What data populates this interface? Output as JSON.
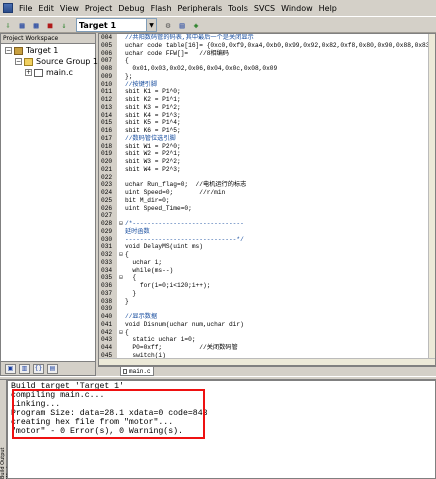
{
  "menubar": {
    "items": [
      "File",
      "Edit",
      "View",
      "Project",
      "Debug",
      "Flash",
      "Peripherals",
      "Tools",
      "SVCS",
      "Window",
      "Help"
    ]
  },
  "toolbar": {
    "target": "Target 1"
  },
  "sidebar": {
    "title": "Project Workspace",
    "tree": [
      {
        "label": "Target 1",
        "expander": "−"
      },
      {
        "label": "Source Group 1",
        "expander": "−"
      },
      {
        "label": "main.c",
        "expander": "+"
      }
    ]
  },
  "editor": {
    "lines": [
      {
        "n": "004",
        "f": "",
        "t": "//共阳数码管的码表,其中最后一个是关闭显示",
        "c": "cm"
      },
      {
        "n": "005",
        "f": "",
        "t": "uchar code table[16]= {0xc0,0xf9,0xa4,0xb0,0x99,0x92,0x82,0xf8,0x80,0x90,0x88,0x83,0xc6,0xa1,0x86,0xff};",
        "c": ""
      },
      {
        "n": "006",
        "f": "",
        "t": "uchar code FFW[]=   //8相编码",
        "c": ""
      },
      {
        "n": "007",
        "f": "",
        "t": "{",
        "c": ""
      },
      {
        "n": "008",
        "f": "",
        "t": "  0x01,0x03,0x02,0x06,0x04,0x0c,0x08,0x09",
        "c": ""
      },
      {
        "n": "009",
        "f": "",
        "t": "};",
        "c": ""
      },
      {
        "n": "010",
        "f": "",
        "t": "//按键引脚",
        "c": "cm"
      },
      {
        "n": "011",
        "f": "",
        "t": "sbit K1 = P1^0;",
        "c": ""
      },
      {
        "n": "012",
        "f": "",
        "t": "sbit K2 = P1^1;",
        "c": ""
      },
      {
        "n": "013",
        "f": "",
        "t": "sbit K3 = P1^2;",
        "c": ""
      },
      {
        "n": "014",
        "f": "",
        "t": "sbit K4 = P1^3;",
        "c": ""
      },
      {
        "n": "015",
        "f": "",
        "t": "sbit K5 = P1^4;",
        "c": ""
      },
      {
        "n": "016",
        "f": "",
        "t": "sbit K6 = P1^5;",
        "c": ""
      },
      {
        "n": "017",
        "f": "",
        "t": "//数码管位选引脚",
        "c": "cm"
      },
      {
        "n": "018",
        "f": "",
        "t": "sbit W1 = P2^0;",
        "c": ""
      },
      {
        "n": "019",
        "f": "",
        "t": "sbit W2 = P2^1;",
        "c": ""
      },
      {
        "n": "020",
        "f": "",
        "t": "sbit W3 = P2^2;",
        "c": ""
      },
      {
        "n": "021",
        "f": "",
        "t": "sbit W4 = P2^3;",
        "c": ""
      },
      {
        "n": "022",
        "f": "",
        "t": "",
        "c": ""
      },
      {
        "n": "023",
        "f": "",
        "t": "uchar Run_flag=0;  //电机运行的标志",
        "c": ""
      },
      {
        "n": "024",
        "f": "",
        "t": "uint Speed=0;       //r/min",
        "c": ""
      },
      {
        "n": "025",
        "f": "",
        "t": "bit M_dir=0;",
        "c": ""
      },
      {
        "n": "026",
        "f": "",
        "t": "uint Speed_Time=0;",
        "c": ""
      },
      {
        "n": "027",
        "f": "",
        "t": "",
        "c": ""
      },
      {
        "n": "028",
        "f": "⊟",
        "t": "/*------------------------------",
        "c": "cm"
      },
      {
        "n": "029",
        "f": "",
        "t": "延时函数",
        "c": "cm"
      },
      {
        "n": "030",
        "f": "",
        "t": "------------------------------*/",
        "c": "cm"
      },
      {
        "n": "031",
        "f": "",
        "t": "void DelayMS(uint ms)",
        "c": ""
      },
      {
        "n": "032",
        "f": "⊟",
        "t": "{",
        "c": ""
      },
      {
        "n": "033",
        "f": "",
        "t": "  uchar i;",
        "c": ""
      },
      {
        "n": "034",
        "f": "",
        "t": "  while(ms--)",
        "c": ""
      },
      {
        "n": "035",
        "f": "⊟",
        "t": "  {",
        "c": ""
      },
      {
        "n": "036",
        "f": "",
        "t": "    for(i=0;i<120;i++);",
        "c": ""
      },
      {
        "n": "037",
        "f": "",
        "t": "  }",
        "c": ""
      },
      {
        "n": "038",
        "f": "",
        "t": "}",
        "c": ""
      },
      {
        "n": "039",
        "f": "",
        "t": "",
        "c": ""
      },
      {
        "n": "040",
        "f": "",
        "t": "//显示数据",
        "c": "cm"
      },
      {
        "n": "041",
        "f": "",
        "t": "void Disnum(uchar num,uchar dir)",
        "c": ""
      },
      {
        "n": "042",
        "f": "⊟",
        "t": "{",
        "c": ""
      },
      {
        "n": "043",
        "f": "",
        "t": "  static uchar i=0;",
        "c": ""
      },
      {
        "n": "044",
        "f": "",
        "t": "  P0=0xff;          //关闭数码管",
        "c": ""
      },
      {
        "n": "045",
        "f": "",
        "t": "  switch(i)",
        "c": ""
      },
      {
        "n": "046",
        "f": "⊟",
        "t": "  {",
        "c": ""
      },
      {
        "n": "047",
        "f": "",
        "t": "  case 0:",
        "c": ""
      },
      {
        "n": "048",
        "f": "",
        "t": "    W1=1;W2=0;W3=0;W4=0;//位选",
        "c": ""
      },
      {
        "n": "049",
        "f": "",
        "t": "    if(dir==0)//正向不显示",
        "c": ""
      },
      {
        "n": "050",
        "f": "⊟",
        "t": "    {",
        "c": ""
      },
      {
        "n": "051",
        "f": "",
        "t": "      P0=0xff;",
        "c": ""
      },
      {
        "n": "052",
        "f": "",
        "t": "    }",
        "c": ""
      }
    ]
  },
  "doc_tab": {
    "label": "main.c"
  },
  "output": {
    "title": "Build Output Window",
    "lines": [
      "Build target 'Target 1'",
      "compiling main.c...",
      "linking...",
      "Program Size: data=28.1 xdata=0 code=843",
      "creating hex file from \"motor\"...",
      "\"motor\" - 0 Error(s), 0 Warning(s)."
    ]
  }
}
